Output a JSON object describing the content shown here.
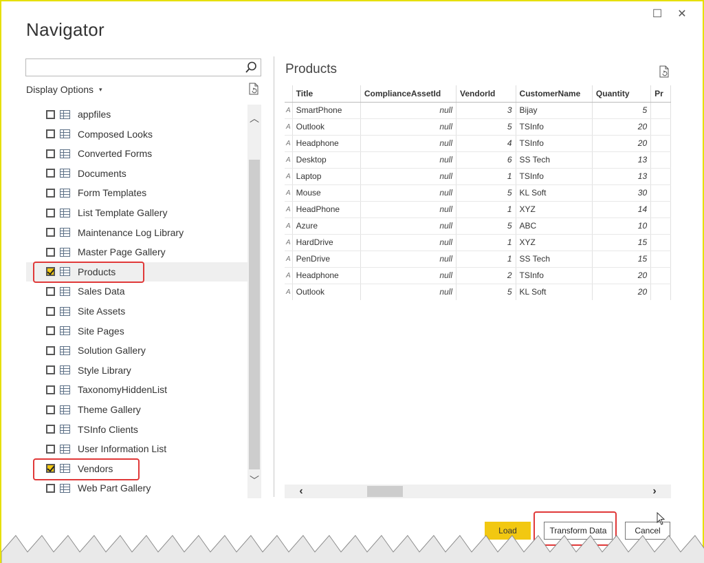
{
  "window": {
    "title": "Navigator",
    "maximize_glyph": "☐",
    "close_glyph": "✕"
  },
  "search": {
    "value": "",
    "placeholder": "",
    "icon": "search-icon"
  },
  "display_options": {
    "label": "Display Options",
    "caret": "▾"
  },
  "tree": {
    "items": [
      {
        "label": "appfiles",
        "checked": false
      },
      {
        "label": "Composed Looks",
        "checked": false
      },
      {
        "label": "Converted Forms",
        "checked": false
      },
      {
        "label": "Documents",
        "checked": false
      },
      {
        "label": "Form Templates",
        "checked": false
      },
      {
        "label": "List Template Gallery",
        "checked": false
      },
      {
        "label": "Maintenance Log Library",
        "checked": false
      },
      {
        "label": "Master Page Gallery",
        "checked": false
      },
      {
        "label": "Products",
        "checked": true
      },
      {
        "label": "Sales Data",
        "checked": false
      },
      {
        "label": "Site Assets",
        "checked": false
      },
      {
        "label": "Site Pages",
        "checked": false
      },
      {
        "label": "Solution Gallery",
        "checked": false
      },
      {
        "label": "Style Library",
        "checked": false
      },
      {
        "label": "TaxonomyHiddenList",
        "checked": false
      },
      {
        "label": "Theme Gallery",
        "checked": false
      },
      {
        "label": "TSInfo Clients",
        "checked": false
      },
      {
        "label": "User Information List",
        "checked": false
      },
      {
        "label": "Vendors",
        "checked": true
      },
      {
        "label": "Web Part Gallery",
        "checked": false
      }
    ],
    "scroll_up": "︿",
    "scroll_down": "﹀"
  },
  "preview": {
    "title": "Products",
    "columns": [
      "",
      "Title",
      "ComplianceAssetId",
      "VendorId",
      "CustomerName",
      "Quantity",
      "Pr"
    ],
    "rows": [
      [
        "A",
        "SmartPhone",
        "null",
        "3",
        "Bijay",
        "5"
      ],
      [
        "A",
        "Outlook",
        "null",
        "5",
        "TSInfo",
        "20"
      ],
      [
        "A",
        "Headphone",
        "null",
        "4",
        "TSInfo",
        "20"
      ],
      [
        "A",
        "Desktop",
        "null",
        "6",
        "SS Tech",
        "13"
      ],
      [
        "A",
        "Laptop",
        "null",
        "1",
        "TSInfo",
        "13"
      ],
      [
        "A",
        "Mouse",
        "null",
        "5",
        "KL Soft",
        "30"
      ],
      [
        "A",
        "HeadPhone",
        "null",
        "1",
        "XYZ",
        "14"
      ],
      [
        "A",
        "Azure",
        "null",
        "5",
        "ABC",
        "10"
      ],
      [
        "A",
        "HardDrive",
        "null",
        "1",
        "XYZ",
        "15"
      ],
      [
        "A",
        "PenDrive",
        "null",
        "1",
        "SS Tech",
        "15"
      ],
      [
        "A",
        "Headphone",
        "null",
        "2",
        "TSInfo",
        "20"
      ],
      [
        "A",
        "Outlook",
        "null",
        "5",
        "KL Soft",
        "20"
      ]
    ],
    "scroll_left": "‹",
    "scroll_right": "›"
  },
  "buttons": {
    "load": "Load",
    "transform": "Transform Data",
    "cancel": "Cancel"
  },
  "colors": {
    "accent": "#f2c811",
    "highlight_box": "#e03838",
    "frame_border": "#e6e000"
  }
}
